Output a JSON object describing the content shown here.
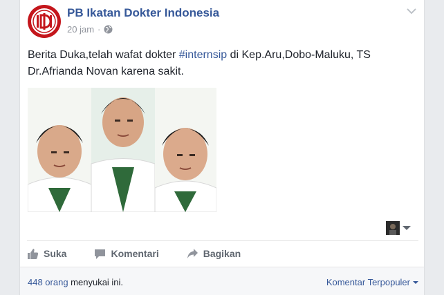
{
  "post": {
    "page_name": "PB Ikatan Dokter Indonesia",
    "time": "20 jam",
    "separator": "·",
    "text_before": "Berita Duka,telah wafat dokter ",
    "hashtag": "#internsip",
    "text_after": " di Kep.Aru,Dobo-Maluku, TS Dr.Afrianda Novan karena sakit.",
    "logo_text": "IDI"
  },
  "actions": {
    "like": "Suka",
    "comment": "Komentari",
    "share": "Bagikan"
  },
  "footer": {
    "likes_count": "448 orang",
    "likes_suffix": " menyukai ini.",
    "sort_label": "Komentar Terpopuler"
  },
  "colors": {
    "link": "#365899",
    "background": "#e9ebee",
    "logo_red": "#c4161c"
  }
}
